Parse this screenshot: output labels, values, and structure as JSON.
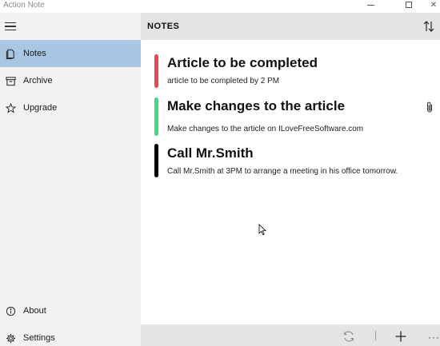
{
  "window": {
    "title": "Action Note",
    "controls": {
      "minimize_icon": "minimize-icon",
      "maximize_icon": "maximize-icon",
      "close_glyph": "✕"
    }
  },
  "sidebar": {
    "menu_icon": "hamburger-icon",
    "items": [
      {
        "label": "Notes",
        "icon": "notes-icon",
        "selected": true
      },
      {
        "label": "Archive",
        "icon": "archive-icon",
        "selected": false
      },
      {
        "label": "Upgrade",
        "icon": "star-icon",
        "selected": false
      }
    ],
    "footer_items": [
      {
        "label": "About",
        "icon": "info-icon"
      },
      {
        "label": "Settings",
        "icon": "gear-icon"
      }
    ],
    "selected_color": "#a9c6e2"
  },
  "header": {
    "title": "NOTES",
    "sort_icon": "sort-icon"
  },
  "notes": [
    {
      "title": "Article to be completed",
      "body": "article to be completed by 2 PM",
      "color": "#e8484e",
      "has_attachment": false
    },
    {
      "title": "Make changes to the article",
      "body": "Make changes to the article on ILoveFreeSoftware.com",
      "color": "#3ddc84",
      "has_attachment": true
    },
    {
      "title": "Call Mr.Smith",
      "body": "Call Mr.Smith at 3PM to arrange a meeting in his office tomorrow.",
      "color": "#000000",
      "has_attachment": false
    }
  ],
  "bottombar": {
    "sync_icon": "sync-icon",
    "add_icon": "add-icon",
    "more_label": "···"
  }
}
